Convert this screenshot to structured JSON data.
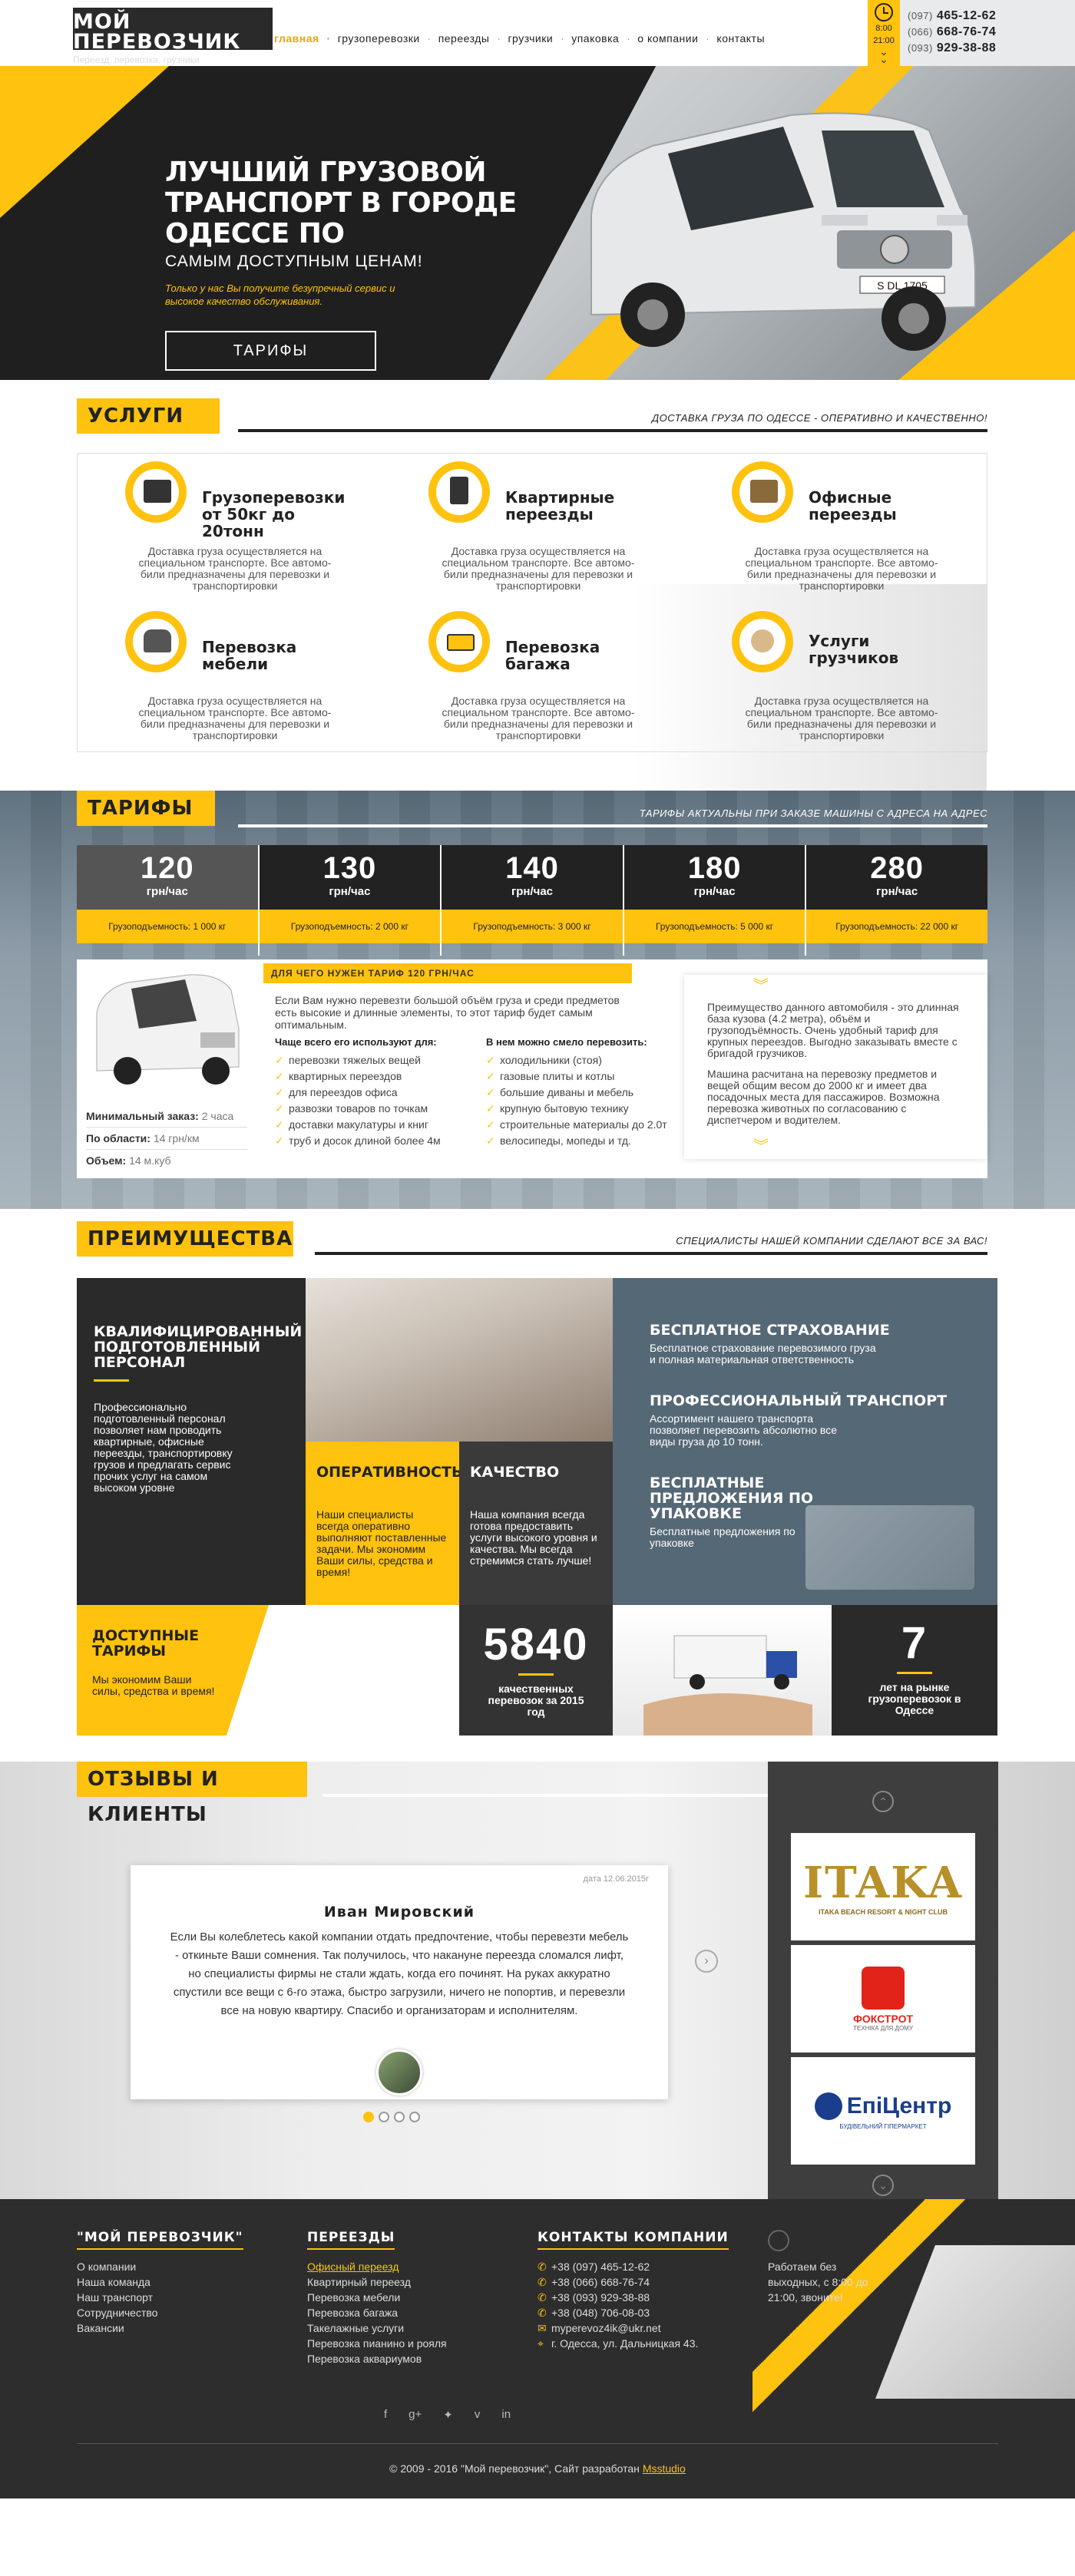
{
  "header": {
    "logo_title": "Мой перевозчик",
    "logo_sub": "Переезд, перевозка, грузчики",
    "nav": [
      "главная",
      "грузоперевозки",
      "переезды",
      "грузчики",
      "упаковка",
      "о компании",
      "контакты"
    ],
    "hours_from": "8:00",
    "hours_to": "21:00",
    "phones": [
      {
        "code": "(097)",
        "num": "465-12-62"
      },
      {
        "code": "(066)",
        "num": "668-76-74"
      },
      {
        "code": "(093)",
        "num": "929-38-88"
      }
    ]
  },
  "hero": {
    "title": "Лучший грузовой транспорт в городе Одессе по",
    "subtitle": "самым доступным ценам!",
    "note": "Только у нас Вы получите безупречный сервис и высокое качество обслуживания.",
    "button": "Тарифы",
    "plate": "S DL 1705"
  },
  "services": {
    "title": "Услуги",
    "subtitle": "Доставка груза по Одессе - оперативно и качественно!",
    "items": [
      {
        "name": "Грузоперевозки от 50кг до 20тонн",
        "icon": "truck-icon",
        "desc": "Доставка груза осуществляется на специальном транспорте. Все автомо-били предназначены для перевозки и транспортировки"
      },
      {
        "name": "Квартирные переезды",
        "icon": "building-icon",
        "desc": "Доставка груза осуществляется на специальном транспорте. Все автомо-били предназначены для перевозки и транспортировки"
      },
      {
        "name": "Офисные переезды",
        "icon": "boxes-icon",
        "desc": "Доставка груза осуществляется на специальном транспорте. Все автомо-били предназначены для перевозки и транспортировки"
      },
      {
        "name": "Перевозка мебели",
        "icon": "armchair-icon",
        "desc": "Доставка груза осуществляется на специальном транспорте. Все автомо-били предназначены для перевозки и транспортировки"
      },
      {
        "name": "Перевозка багажа",
        "icon": "van-icon",
        "desc": "Доставка груза осуществляется на специальном транспорте. Все автомо-били предназначены для перевозки и транспортировки"
      },
      {
        "name": "Услуги грузчиков",
        "icon": "worker-icon",
        "desc": "Доставка груза осуществляется на специальном транспорте. Все автомо-били предназначены для перевозки и транспортировки"
      }
    ]
  },
  "tarifs": {
    "title": "Тарифы",
    "subtitle": "Тарифы актуальны при заказе машины с адреса на адрес",
    "cards": [
      {
        "price": "120",
        "unit": "грн/час",
        "cap": "Грузоподъемность: 1 000 кг"
      },
      {
        "price": "130",
        "unit": "грн/час",
        "cap": "Грузоподъемность: 2 000 кг"
      },
      {
        "price": "140",
        "unit": "грн/час",
        "cap": "Грузоподъемность: 3 000 кг"
      },
      {
        "price": "180",
        "unit": "грн/час",
        "cap": "Грузоподъемность: 5 000 кг"
      },
      {
        "price": "280",
        "unit": "грн/час",
        "cap": "Грузоподъемность: 22 000 кг"
      }
    ],
    "info": [
      {
        "label": "Минимальный заказ:",
        "value": "2 часа"
      },
      {
        "label": "По области:",
        "value": "14 грн/км"
      },
      {
        "label": "Объем:",
        "value": "14 м.куб"
      }
    ],
    "why_title": "Для чего нужен тариф 120 грн/час",
    "why_desc": "Если Вам нужно перевезти большой объём груза и среди предметов есть высокие и длинные элементы, то этот тариф будет самым оптимальным.",
    "list1_title": "Чаще всего его используют для:",
    "list1": [
      "перевозки тяжелых вещей",
      "квартирных переездов",
      "для переездов офиса",
      "развозки товаров по точкам",
      "доставки макулатуры и книг",
      "труб и досок длиной более 4м"
    ],
    "list2_title": "В нем можно смело перевозить:",
    "list2": [
      "холодильники (стоя)",
      "газовые плиты и котлы",
      "большие диваны и мебель",
      "крупную бытовую технику",
      "строительные материалы до 2.0т",
      "велосипеды, мопеды и тд."
    ],
    "adv_p1": "Преимущество данного автомобиля - это длинная база кузова (4.2 метра), объём и грузоподъёмность. Очень удобный тариф для крупных переездов. Выгодно заказывать вместе с бригадой грузчиков.",
    "adv_p2": "Машина расчитана на перевозку предметов и вещей общим весом до 2000 кг и имеет два посадочных места для пассажиров. Возможна перевозка животных по согласованию с диспетчером и водителем."
  },
  "advantages": {
    "title": "Преимущества",
    "subtitle": "Специалисты нашей компании сделают все за вас!",
    "staff_title": "Квалифицированный подготовленный персонал",
    "staff_text": "Профессионально подготовленный персонал позволяет нам проводить квартирные, офисные переезды, транспортировку грузов и предлагать сервис прочих услуг на самом высоком уровне",
    "speed_title": "Оперативность",
    "speed_text": "Наши специалисты всегда оперативно выполняют поставленные задачи. Мы экономим  Ваши силы, средства и время!",
    "quality_title": "Качество",
    "quality_text": "Наша компания всегда готова предоставить услуги высокого уровня и качества. Мы всегда стремимся стать лучше!",
    "insurance_title": "Бесплатное страхование",
    "insurance_text": "Бесплатное страхование перевозимого груза и полная материальная ответственность",
    "transport_title": "Профессиональный транспорт",
    "transport_text": "Ассортимент нашего транспорта позволяет перевозить абсолютно все виды груза до 10 тонн.",
    "packing_title": "Бесплатные предложения по упаковке",
    "packing_text": "Бесплатные предложения по упаковке",
    "prices_title": "Доступные тарифы",
    "prices_text": "Мы экономим  Ваши силы, средства и время!",
    "count_num": "5840",
    "count_text": "качественных перевозок за 2015 год",
    "years_num": "7",
    "years_text": "лет на рынке грузоперевозок в Одессе"
  },
  "reviews": {
    "title": "Отзывы и клиенты",
    "date": "дата 12.06.2015г",
    "name": "Иван Мировский",
    "text": "Если Вы колеблетесь какой компании отдать предпочтение, чтобы перевезти мебель - откиньте Ваши сомнения. Так получилось, что накануне переезда сломался лифт, но специалисты фирмы не стали ждать, когда его починят. На руках аккуратно спустили все вещи с 6-го этажа, быстро загрузили, ничего не попортив, и перевезли все на новую квартиру. Спасибо и организаторам и исполнителям.",
    "clients": [
      {
        "name": "ITAKA",
        "sub": "ITAKA BEACH RESORT & NIGHT CLUB"
      },
      {
        "name": "ФОКСТРОТ",
        "sub": "ТЕХНІКА ДЛЯ ДОМУ"
      },
      {
        "name": "ЕпіЦентр",
        "sub": "БУДІВЕЛЬНИЙ ГІПЕРМАРКЕТ"
      }
    ]
  },
  "footer": {
    "col1_title": "\"Мой перевозчик\"",
    "col1": [
      "О компании",
      "Наша команда",
      "Наш транспорт",
      "Сотрудничество",
      "Вакансии"
    ],
    "col2_title": "Переезды",
    "col2": [
      "Офисный переезд",
      "Квартирный переезд",
      "Перевозка мебели",
      "Перевозка багажа",
      "Такелажные услуги",
      "Перевозка пианино и рояля",
      "Перевозка аквариумов"
    ],
    "col3_title": "Контакты компании",
    "contacts": [
      "+38 (097) 465-12-62",
      "+38 (066) 668-76-74",
      "+38 (093) 929-38-88",
      "+38 (048) 706-08-03",
      "myperevoz4ik@ukr.net",
      "г. Одесса, ул. Дальницкая 43."
    ],
    "schedule": "Работаем без выходных, с 8:00 до 21:00, звоните!",
    "copyright": "© 2009 - 2016 \"Мой перевозчик\", Сайт разработан",
    "dev": "Msstudio"
  }
}
